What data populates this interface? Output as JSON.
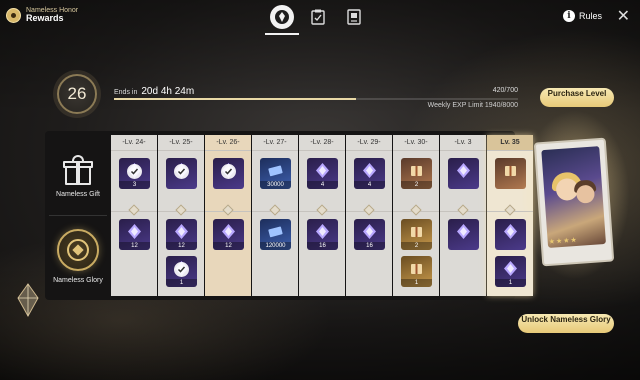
{
  "header": {
    "subtitle": "Nameless Honor",
    "title": "Rewards",
    "tabs": [
      {
        "icon": "emblem-icon",
        "active": true
      },
      {
        "icon": "mission-clipboard-icon",
        "active": false
      },
      {
        "icon": "shop-book-icon",
        "active": false
      }
    ],
    "rules_label": "Rules",
    "rules_icon": "info-icon"
  },
  "level": {
    "current": "26",
    "ends_label": "Ends in",
    "ends_time": "20d 4h 24m",
    "exp": "420/700",
    "exp_fraction": 0.6,
    "weekly_limit": "Weekly EXP Limit 1940/8000",
    "purchase_label": "Purchase Level"
  },
  "tracks": {
    "gift_label": "Nameless Gift",
    "glory_label": "Nameless Glory"
  },
  "columns": [
    {
      "level": "-Lv. 24-",
      "state": "normal",
      "gift": {
        "color": "purple",
        "qty": "3",
        "claimed": true
      },
      "glory": [
        {
          "color": "purple",
          "qty": "12",
          "claimed": false
        }
      ]
    },
    {
      "level": "-Lv. 25-",
      "state": "normal",
      "gift": {
        "color": "purple",
        "qty": "",
        "claimed": true
      },
      "glory": [
        {
          "color": "purple",
          "qty": "12",
          "claimed": false
        },
        {
          "color": "purple",
          "qty": "1",
          "claimed": true
        }
      ]
    },
    {
      "level": "-Lv. 26-",
      "state": "claimed",
      "gift": {
        "color": "purple",
        "qty": "",
        "claimed": true
      },
      "glory": [
        {
          "color": "purple",
          "qty": "12",
          "claimed": false
        }
      ]
    },
    {
      "level": "-Lv. 27-",
      "state": "normal",
      "gift": {
        "color": "blue",
        "qty": "30000",
        "claimed": false
      },
      "glory": [
        {
          "color": "blue",
          "qty": "120000",
          "claimed": false
        }
      ]
    },
    {
      "level": "-Lv. 28-",
      "state": "normal",
      "gift": {
        "color": "purple",
        "qty": "4",
        "claimed": false
      },
      "glory": [
        {
          "color": "purple",
          "qty": "16",
          "claimed": false
        }
      ]
    },
    {
      "level": "-Lv. 29-",
      "state": "normal",
      "gift": {
        "color": "purple",
        "qty": "4",
        "claimed": false
      },
      "glory": [
        {
          "color": "purple",
          "qty": "16",
          "claimed": false
        }
      ]
    },
    {
      "level": "-Lv. 30-",
      "state": "normal",
      "gift": {
        "color": "bronze",
        "qty": "2",
        "claimed": false
      },
      "glory": [
        {
          "color": "gold",
          "qty": "2",
          "claimed": false
        },
        {
          "color": "gold",
          "qty": "1",
          "claimed": false
        }
      ]
    },
    {
      "level": "-Lv. 3",
      "state": "normal",
      "gift": {
        "color": "purple",
        "qty": "",
        "claimed": false
      },
      "glory": [
        {
          "color": "purple",
          "qty": "",
          "claimed": false
        }
      ]
    },
    {
      "level": "Lv. 35",
      "state": "final",
      "gift": {
        "color": "bronze",
        "qty": "",
        "claimed": false
      },
      "glory": [
        {
          "color": "purple",
          "qty": "",
          "claimed": false
        },
        {
          "color": "purple",
          "qty": "1",
          "claimed": false
        }
      ]
    }
  ],
  "unlock_label": "Unlock Nameless Glory",
  "colors": {
    "accent": "#e7c978",
    "panel": "#dcdad6"
  }
}
